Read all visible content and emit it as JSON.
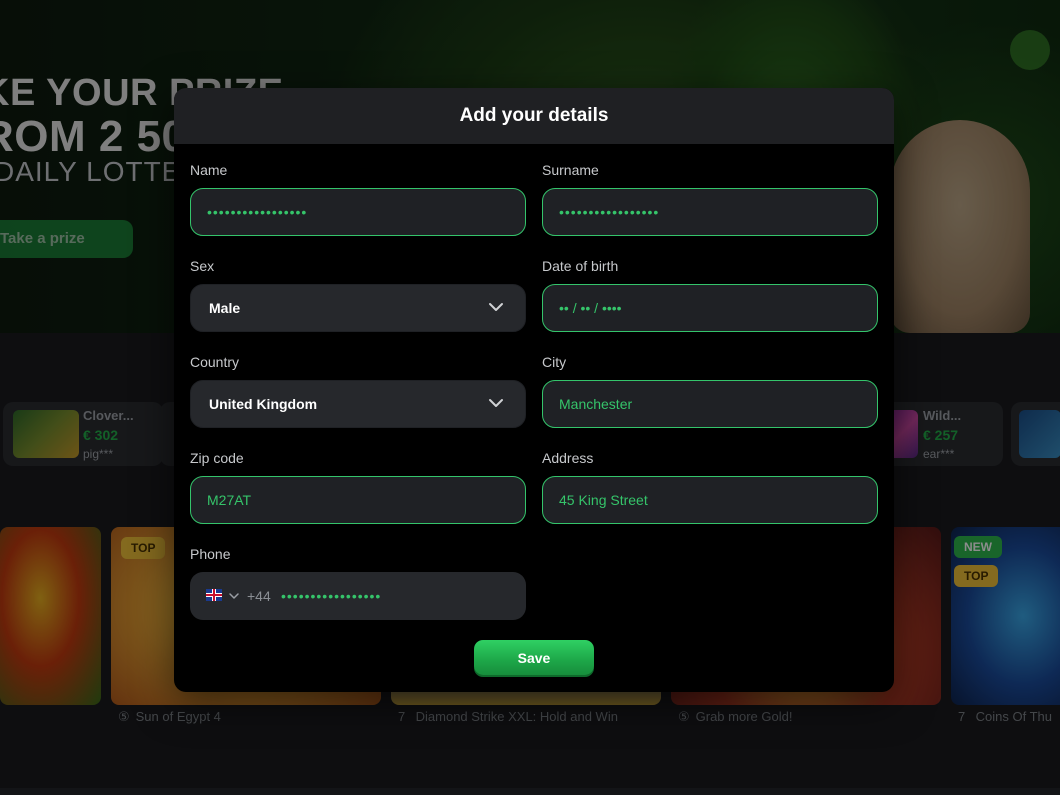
{
  "banner": {
    "line1": "KE YOUR PRIZE",
    "line2": "ROM 2 50",
    "line3": "DAILY LOTTER",
    "button_label": "Take a prize"
  },
  "winners": [
    {
      "name": "Clover...",
      "amount": "€ 302",
      "user": "pig***"
    },
    {
      "name": "Wild...",
      "amount": "€ 257",
      "user": "ear***"
    }
  ],
  "games": [
    {
      "title": "Sun of Egypt 4",
      "badges": [
        "TOP"
      ]
    },
    {
      "title": "Diamond Strike XXL: Hold and Win",
      "badges": []
    },
    {
      "title": "Grab more Gold!",
      "badges": []
    },
    {
      "title": "Coins Of Thu",
      "badges": [
        "NEW",
        "TOP"
      ]
    }
  ],
  "modal": {
    "title": "Add your details",
    "fields": {
      "name": {
        "label": "Name",
        "value": "•••••••••••••••••"
      },
      "surname": {
        "label": "Surname",
        "value": "•••••••••••••••••"
      },
      "sex": {
        "label": "Sex",
        "value": "Male"
      },
      "dob": {
        "label": "Date of birth",
        "value": "•• / •• / ••••"
      },
      "country": {
        "label": "Country",
        "value": "United Kingdom"
      },
      "city": {
        "label": "City",
        "value": "Manchester"
      },
      "zip": {
        "label": "Zip code",
        "value": "M27AT"
      },
      "address": {
        "label": "Address",
        "value": "45 King Street"
      },
      "phone": {
        "label": "Phone",
        "country_code": "+44",
        "value": "•••••••••••••••••"
      }
    },
    "save_label": "Save"
  },
  "colors": {
    "accent_green": "#34c46b",
    "modal_header": "#1f2023",
    "modal_body": "#000000",
    "select_bg": "#26282c"
  }
}
